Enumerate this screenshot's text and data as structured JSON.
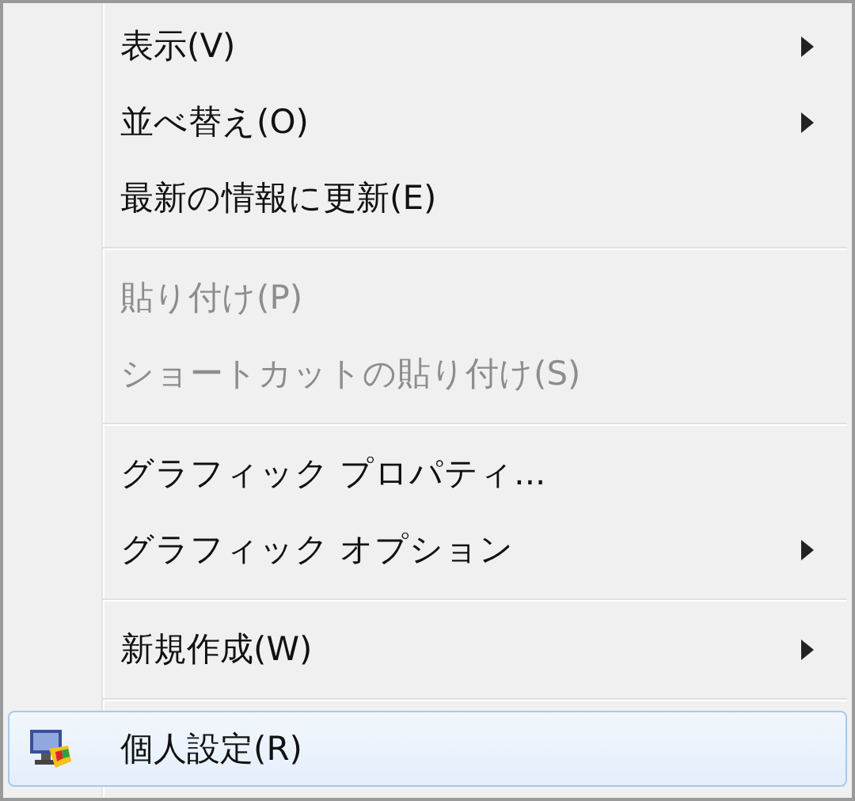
{
  "menu": {
    "items": [
      {
        "kind": "item",
        "label": "表示(V)",
        "disabled": false,
        "submenu": true,
        "selected": false,
        "icon": false
      },
      {
        "kind": "item",
        "label": "並べ替え(O)",
        "disabled": false,
        "submenu": true,
        "selected": false,
        "icon": false
      },
      {
        "kind": "item",
        "label": "最新の情報に更新(E)",
        "disabled": false,
        "submenu": false,
        "selected": false,
        "icon": false
      },
      {
        "kind": "separator"
      },
      {
        "kind": "item",
        "label": "貼り付け(P)",
        "disabled": true,
        "submenu": false,
        "selected": false,
        "icon": false
      },
      {
        "kind": "item",
        "label": "ショートカットの貼り付け(S)",
        "disabled": true,
        "submenu": false,
        "selected": false,
        "icon": false
      },
      {
        "kind": "separator"
      },
      {
        "kind": "item",
        "label": "グラフィック プロパティ...",
        "disabled": false,
        "submenu": false,
        "selected": false,
        "icon": false
      },
      {
        "kind": "item",
        "label": "グラフィック オプション",
        "disabled": false,
        "submenu": true,
        "selected": false,
        "icon": false
      },
      {
        "kind": "separator"
      },
      {
        "kind": "item",
        "label": "新規作成(W)",
        "disabled": false,
        "submenu": true,
        "selected": false,
        "icon": false
      },
      {
        "kind": "separator"
      },
      {
        "kind": "item",
        "label": "個人設定(R)",
        "disabled": false,
        "submenu": false,
        "selected": true,
        "icon": true
      }
    ]
  }
}
